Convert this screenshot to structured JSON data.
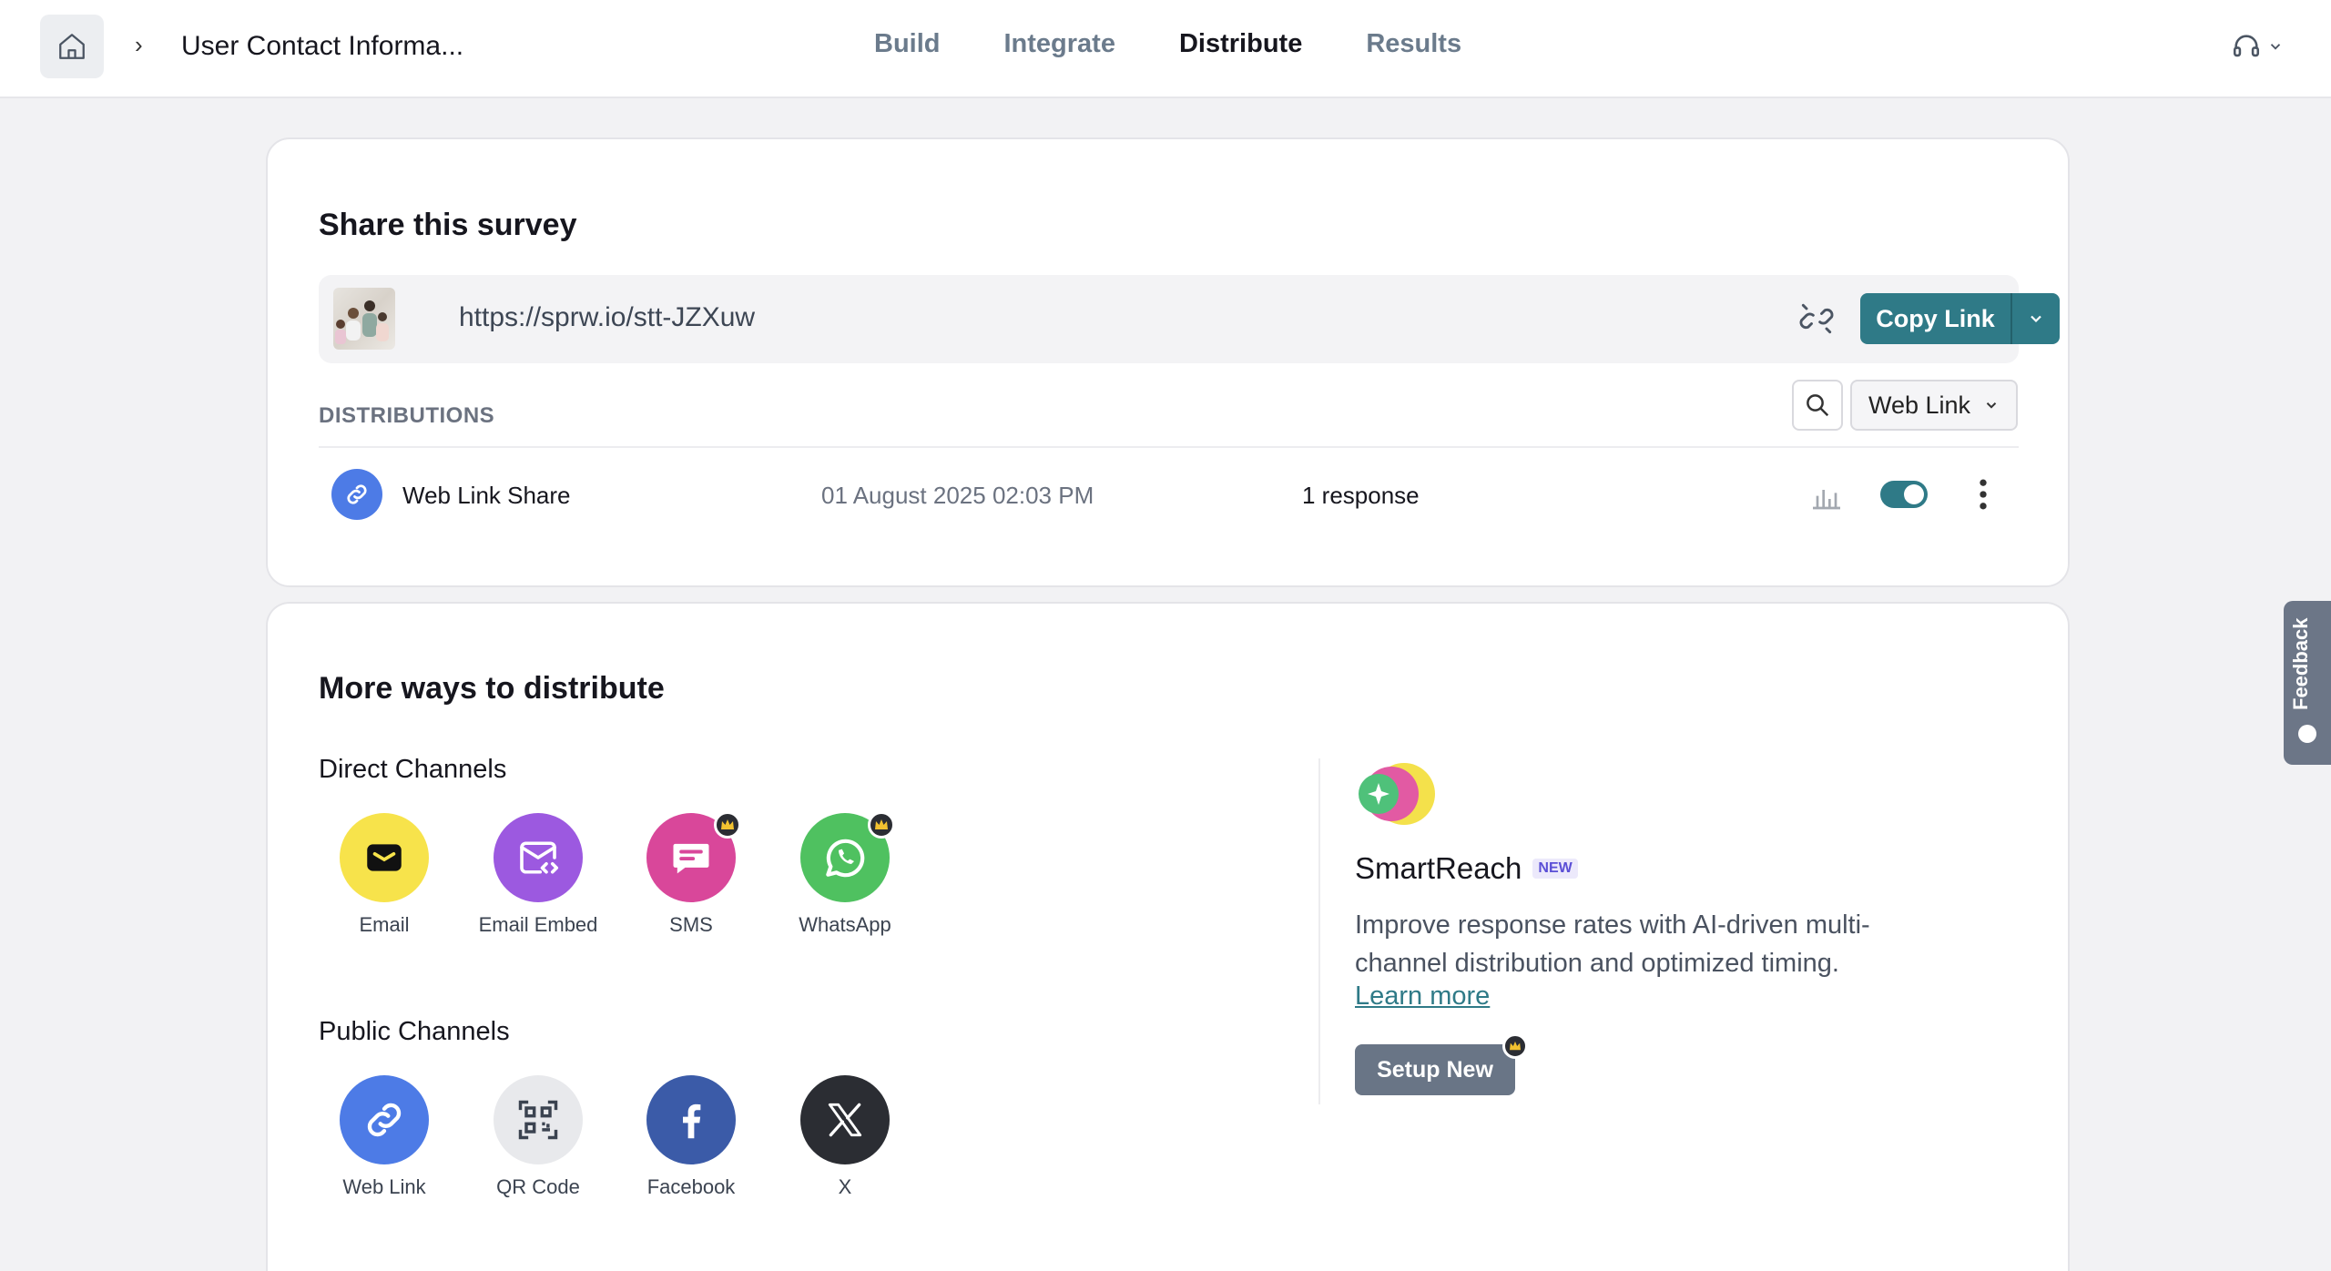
{
  "header": {
    "survey_title": "User Contact Informa...",
    "tabs": [
      {
        "label": "Build",
        "active": false
      },
      {
        "label": "Integrate",
        "active": false
      },
      {
        "label": "Distribute",
        "active": true
      },
      {
        "label": "Results",
        "active": false
      }
    ]
  },
  "share": {
    "title": "Share this survey",
    "url": "https://sprw.io/stt-JZXuw",
    "copy_label": "Copy Link"
  },
  "distributions": {
    "label": "DISTRIBUTIONS",
    "filter_label": "Web Link",
    "rows": [
      {
        "name": "Web Link Share",
        "date": "01 August 2025 02:03 PM",
        "responses": "1 response",
        "enabled": true
      }
    ]
  },
  "more": {
    "title": "More ways to distribute",
    "direct_label": "Direct Channels",
    "direct": [
      {
        "label": "Email",
        "icon": "envelope-icon",
        "color": "#f7e34b",
        "premium": false
      },
      {
        "label": "Email Embed",
        "icon": "email-embed-icon",
        "color": "#9c59e0",
        "premium": false
      },
      {
        "label": "SMS",
        "icon": "sms-icon",
        "color": "#d9479a",
        "premium": true
      },
      {
        "label": "WhatsApp",
        "icon": "whatsapp-icon",
        "color": "#4fc160",
        "premium": true
      }
    ],
    "public_label": "Public Channels",
    "public": [
      {
        "label": "Web Link",
        "icon": "link-icon",
        "color": "#4d7be6",
        "premium": false
      },
      {
        "label": "QR Code",
        "icon": "qr-code-icon",
        "color": "#e8e9ec",
        "premium": false
      },
      {
        "label": "Facebook",
        "icon": "facebook-icon",
        "color": "#3b5ba8",
        "premium": false
      },
      {
        "label": "X",
        "icon": "x-icon",
        "color": "#2b2d33",
        "premium": false
      }
    ]
  },
  "smartreach": {
    "title": "SmartReach",
    "badge": "NEW",
    "description": "Improve response rates with AI-driven multi-channel distribution and optimized timing.",
    "learn_more": "Learn more",
    "setup_label": "Setup New"
  },
  "feedback_label": "Feedback",
  "colors": {
    "accent": "#2f7a87",
    "muted_button": "#697586"
  }
}
